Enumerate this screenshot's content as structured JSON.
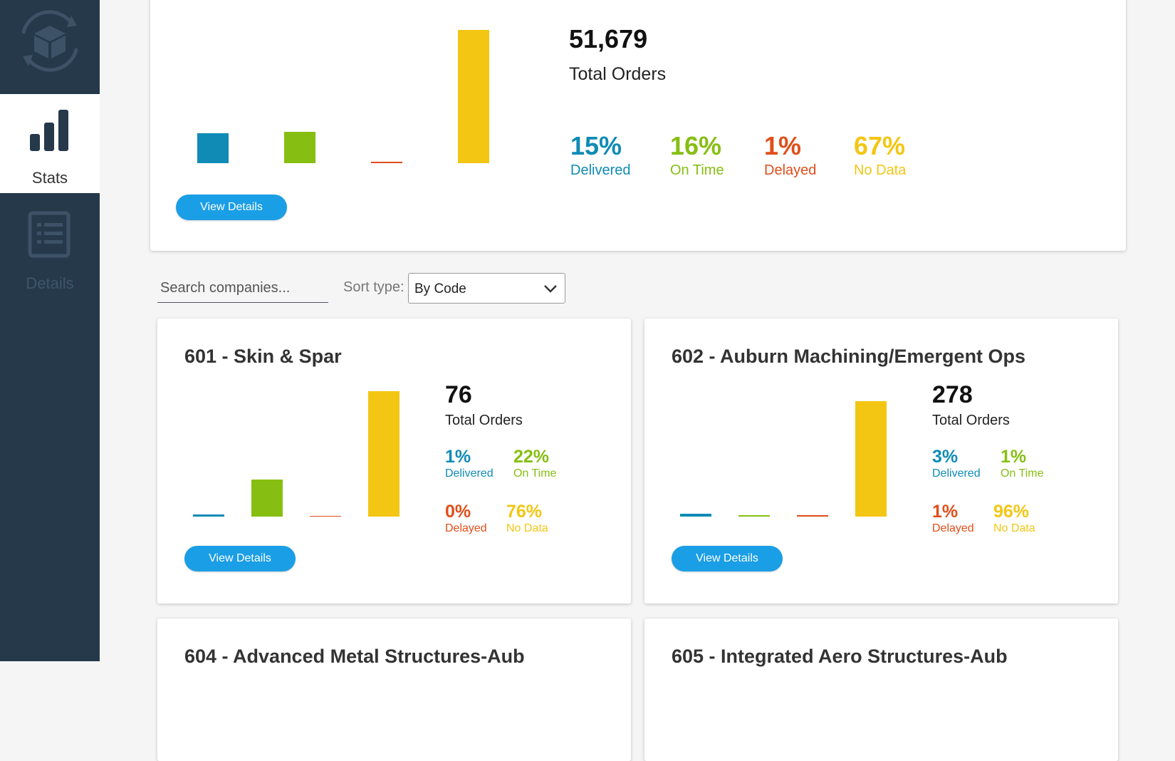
{
  "nav": {
    "items": [
      {
        "label": "Stats",
        "icon": "bar-chart-icon",
        "active": true
      },
      {
        "label": "Details",
        "icon": "list-document-icon",
        "active": false
      }
    ]
  },
  "colors": {
    "delivered": "#0f8bb5",
    "on_time": "#86bf12",
    "delayed": "#e04e1a",
    "no_data": "#f3c614",
    "sidebar": "#25394b",
    "button": "#1a9ee6"
  },
  "summary": {
    "total": "51,679",
    "total_label": "Total Orders",
    "stats": [
      {
        "pct": "15%",
        "label": "Delivered",
        "key": "delivered"
      },
      {
        "pct": "16%",
        "label": "On Time",
        "key": "on_time"
      },
      {
        "pct": "1%",
        "label": "Delayed",
        "key": "delayed"
      },
      {
        "pct": "67%",
        "label": "No Data",
        "key": "no_data"
      }
    ],
    "view_details": "View Details"
  },
  "filters": {
    "search_placeholder": "Search companies...",
    "sort_label": "Sort type:",
    "sort_value": "By Code"
  },
  "companies": [
    {
      "title": "601 - Skin & Spar",
      "total": "76",
      "total_label": "Total Orders",
      "stats": [
        {
          "pct": "1%",
          "label": "Delivered",
          "key": "delivered"
        },
        {
          "pct": "22%",
          "label": "On Time",
          "key": "on_time"
        },
        {
          "pct": "0%",
          "label": "Delayed",
          "key": "delayed"
        },
        {
          "pct": "76%",
          "label": "No Data",
          "key": "no_data"
        }
      ],
      "view_details": "View Details"
    },
    {
      "title": "602 - Auburn Machining/Emergent Ops",
      "total": "278",
      "total_label": "Total Orders",
      "stats": [
        {
          "pct": "3%",
          "label": "Delivered",
          "key": "delivered"
        },
        {
          "pct": "1%",
          "label": "On Time",
          "key": "on_time"
        },
        {
          "pct": "1%",
          "label": "Delayed",
          "key": "delayed"
        },
        {
          "pct": "96%",
          "label": "No Data",
          "key": "no_data"
        }
      ],
      "view_details": "View Details"
    },
    {
      "title": "604 - Advanced Metal Structures-Aub"
    },
    {
      "title": "605 - Integrated Aero Structures-Aub"
    }
  ]
}
